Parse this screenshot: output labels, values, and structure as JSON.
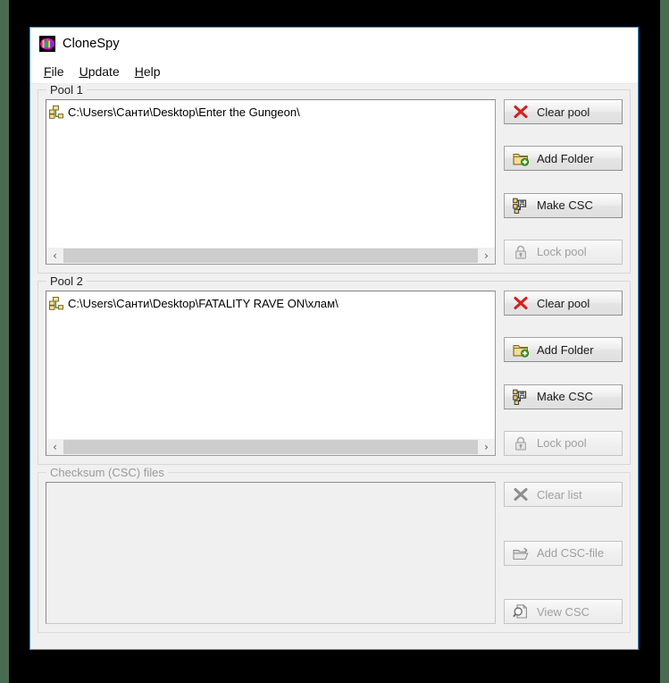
{
  "window": {
    "title": "CloneSpy",
    "icon": "clonespy-app-icon"
  },
  "menubar": {
    "items": [
      {
        "name": "file",
        "accel": "F",
        "rest": "ile"
      },
      {
        "name": "update",
        "accel": "U",
        "rest": "pdate"
      },
      {
        "name": "help",
        "accel": "H",
        "rest": "elp"
      }
    ]
  },
  "pool1": {
    "legend": "Pool 1",
    "items": [
      {
        "icon": "folder-tree-icon",
        "path": "C:\\Users\\Санти\\Desktop\\Enter the Gungeon\\"
      }
    ],
    "scrollbar": {
      "left_arrow": "‹",
      "right_arrow": "›"
    },
    "buttons": [
      {
        "name": "clear-pool",
        "icon": "red-x-icon",
        "label": "Clear pool",
        "disabled": false
      },
      {
        "name": "add-folder",
        "icon": "folder-plus-icon",
        "label": "Add Folder",
        "disabled": false
      },
      {
        "name": "make-csc",
        "icon": "make-csc-icon",
        "label": "Make CSC",
        "disabled": false
      },
      {
        "name": "lock-pool",
        "icon": "lock-icon",
        "label": "Lock pool",
        "disabled": true
      }
    ]
  },
  "pool2": {
    "legend": "Pool 2",
    "items": [
      {
        "icon": "folder-tree-icon",
        "path": "C:\\Users\\Санти\\Desktop\\FATALITY RAVE ON\\хлам\\"
      }
    ],
    "scrollbar": {
      "left_arrow": "‹",
      "right_arrow": "›"
    },
    "buttons": [
      {
        "name": "clear-pool",
        "icon": "red-x-icon",
        "label": "Clear pool",
        "disabled": false
      },
      {
        "name": "add-folder",
        "icon": "folder-plus-icon",
        "label": "Add Folder",
        "disabled": false
      },
      {
        "name": "make-csc",
        "icon": "make-csc-icon",
        "label": "Make CSC",
        "disabled": false
      },
      {
        "name": "lock-pool",
        "icon": "lock-icon",
        "label": "Lock pool",
        "disabled": true
      }
    ]
  },
  "checksum": {
    "legend": "Checksum (CSC) files",
    "disabled": true,
    "items": [],
    "buttons": [
      {
        "name": "clear-list",
        "icon": "grey-x-icon",
        "label": "Clear list",
        "disabled": true
      },
      {
        "name": "add-csc-file",
        "icon": "open-folder-icon",
        "label": "Add CSC-file",
        "disabled": true
      },
      {
        "name": "view-csc",
        "icon": "magnifier-page-icon",
        "label": "View CSC",
        "disabled": true
      }
    ]
  },
  "colors": {
    "window_border": "#3399e6",
    "desktop_matte": "#000000",
    "outer_edge": "#4a6b52",
    "face": "#f0f0f0",
    "accent_red": "#d42020",
    "accent_yellow": "#f2d16b",
    "accent_green": "#4caf2a",
    "disabled_text": "#a0a0a0"
  }
}
